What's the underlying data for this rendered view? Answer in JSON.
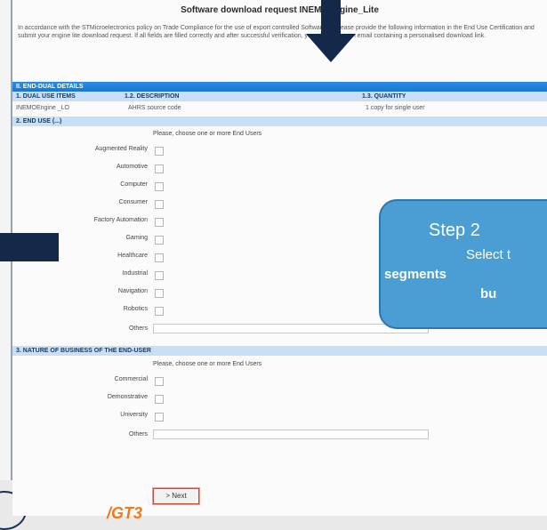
{
  "form": {
    "title": "Software download request INEMOEngine_Lite",
    "intro": "In accordance with the STMicroelectronics policy on Trade Compliance for the use of export controlled Software IP, please provide the following information in the End Use Certification and submit your engine lite download request. If all fields are filled correctly and after successful verification, you will receive an email containing a personalised download link.",
    "section_ii": "II. END-DUAL DETAILS",
    "columns": {
      "items": "1. DUAL USE ITEMS",
      "description": "1.2. DESCRIPTION",
      "quantity": "1.3. QUANTITY"
    },
    "row": {
      "item": "INEMOEngine _LO",
      "description": "AHRS source code",
      "quantity": "1 copy for single user"
    },
    "section_end_use": "2. END USE (...)",
    "end_use_prompt": "Please, choose one or more End Users",
    "end_uses": [
      "Augmented Reality",
      "Automotive",
      "Computer",
      "Consumer",
      "Factory Automation",
      "Gaming",
      "Healthcare",
      "Industrial",
      "Navigation",
      "Robotics"
    ],
    "others_label": "Others",
    "section_nature": "3. NATURE OF BUSINESS OF THE END-USER",
    "nature_prompt": "Please, choose one or more End Users",
    "nature_options": [
      "Commercial",
      "Demonstrative",
      "University"
    ],
    "others_label_2": "Others",
    "next_label": "> Next"
  },
  "callout": {
    "line1": "Step 2",
    "line2": "Select t",
    "line3": "segments",
    "line4": "bu"
  },
  "bottom_text": "/GT3",
  "colors": {
    "header_blue": "#1976d2",
    "sub_header": "#c9dff5",
    "callout_blue": "#4a9ed3",
    "arrow_navy": "#14284a",
    "orange": "#f07a1a"
  }
}
